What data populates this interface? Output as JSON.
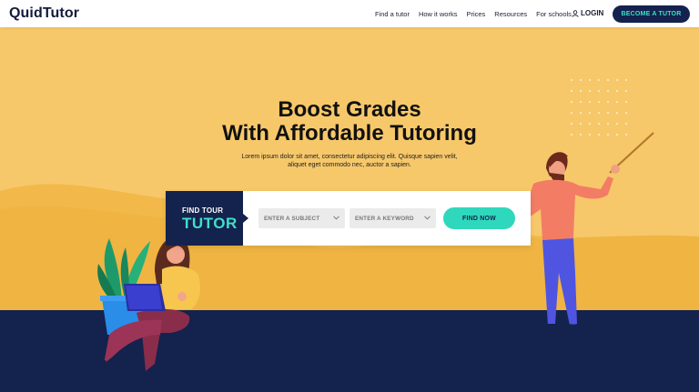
{
  "brand": {
    "logo": "QuidTutor"
  },
  "nav": {
    "links": [
      "Find a tutor",
      "How it works",
      "Prices",
      "Resources",
      "For schools"
    ],
    "login_label": "LOGIN",
    "cta_label": "BECOME A TUTOR"
  },
  "hero": {
    "headline_line1": "Boost Grades",
    "headline_line2": "With Affordable Tutoring",
    "sub_line1": "Lorem ipsum dolor sit amet, consectetur adipiscing elit. Quisque sapien velit,",
    "sub_line2": "aliquet eget commodo nec, auctor a sapien."
  },
  "search": {
    "label_small": "FIND TOUR",
    "label_big": "TUTOR",
    "subject_placeholder": "ENTER A SUBJECT",
    "keyword_placeholder": "ENTER A KEYWORD",
    "button_label": "FIND NOW"
  },
  "colors": {
    "navy": "#14224e",
    "teal": "#3ee0c8",
    "hero_yellow": "#f7c86a"
  },
  "icons": [
    "user-icon",
    "chevron-down-icon"
  ]
}
